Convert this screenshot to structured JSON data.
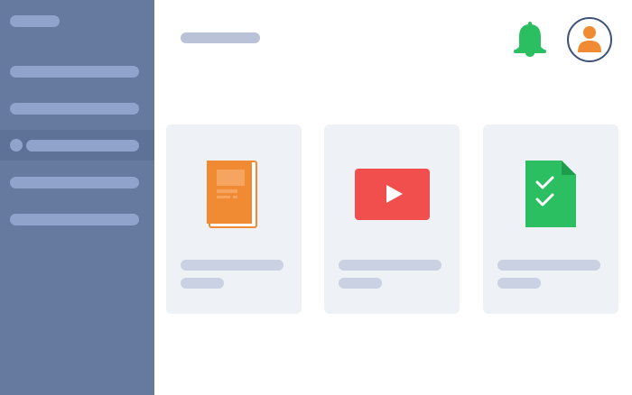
{
  "sidebar": {
    "items": [
      {
        "label": ""
      },
      {
        "label": ""
      },
      {
        "label": "",
        "active": true
      },
      {
        "label": ""
      },
      {
        "label": ""
      }
    ]
  },
  "header": {
    "icons": [
      "bell-icon",
      "user-avatar-icon"
    ]
  },
  "cards": [
    {
      "icon": "book-icon",
      "accent": "#f08a33"
    },
    {
      "icon": "video-play-icon",
      "accent": "#f14e4e"
    },
    {
      "icon": "checklist-document-icon",
      "accent": "#2bbf62"
    }
  ],
  "colors": {
    "sidebar": "#667aa0",
    "sidebar_active": "#5e7196",
    "placeholder": "#90a3ca",
    "card_background": "#eef1f6",
    "bell": "#2bbf62",
    "avatar_person": "#f08a33",
    "avatar_border": "#3f5278"
  }
}
